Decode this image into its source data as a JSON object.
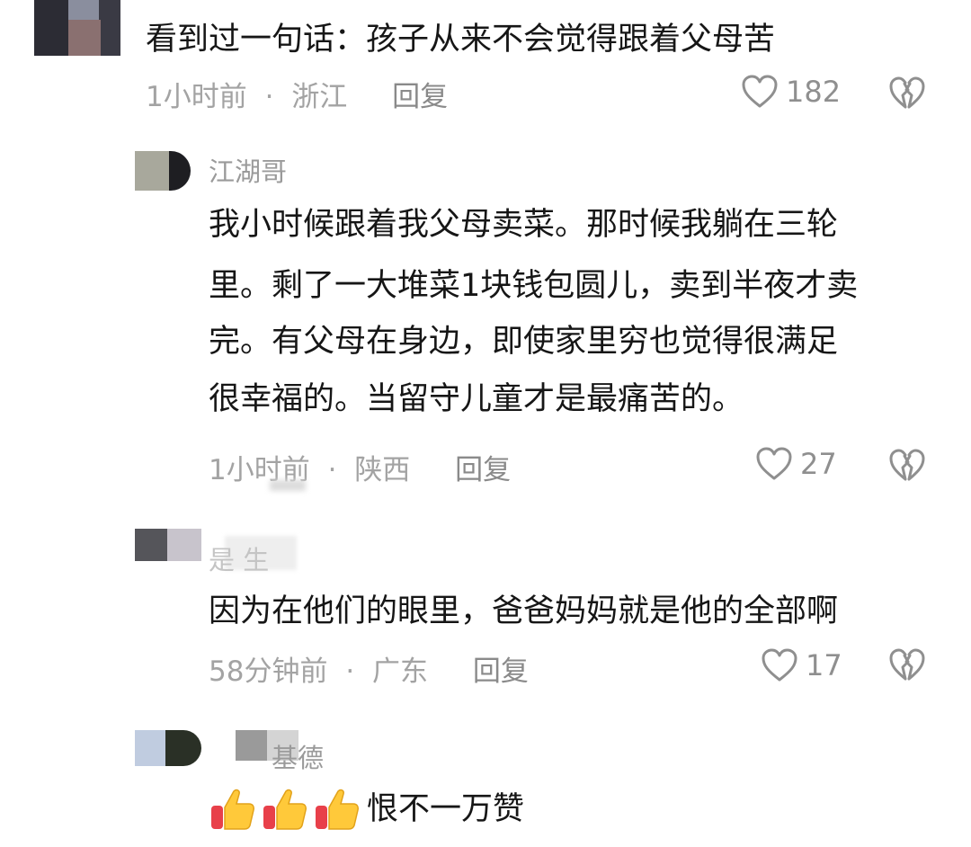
{
  "comments": [
    {
      "text": "看到过一句话：孩子从来不会觉得跟着父母苦",
      "time": "1小时前",
      "location": "浙江",
      "reply_label": "回复",
      "likes": "182"
    },
    {
      "username": "江湖哥",
      "lines": [
        "我小时候跟着我父母卖菜。那时候我躺在三轮",
        "里。剩了一大堆菜1块钱包圆儿，卖到半夜才卖",
        "完。有父母在身边，即使家里穷也觉得很满足",
        "很幸福的。当留守儿童才是最痛苦的。"
      ],
      "time": "1小时前",
      "location": "陕西",
      "reply_label": "回复",
      "likes": "27"
    },
    {
      "username": "是  生",
      "text": "因为在他们的眼里，爸爸妈妈就是他的全部啊",
      "time": "58分钟前",
      "location": "广东",
      "reply_label": "回复",
      "likes": "17"
    },
    {
      "username": "基德",
      "text": "恨不一万赞",
      "emoji_count": 3
    }
  ],
  "separator": "·",
  "icons": {
    "like": "heart-outline-icon",
    "dislike": "broken-heart-icon",
    "emoji": "thumbs-up-emoji-icon"
  },
  "colors": {
    "text": "#161616",
    "meta": "#a3a3a3",
    "icon": "#8f8f8f",
    "thumb": "#ffc93a"
  }
}
